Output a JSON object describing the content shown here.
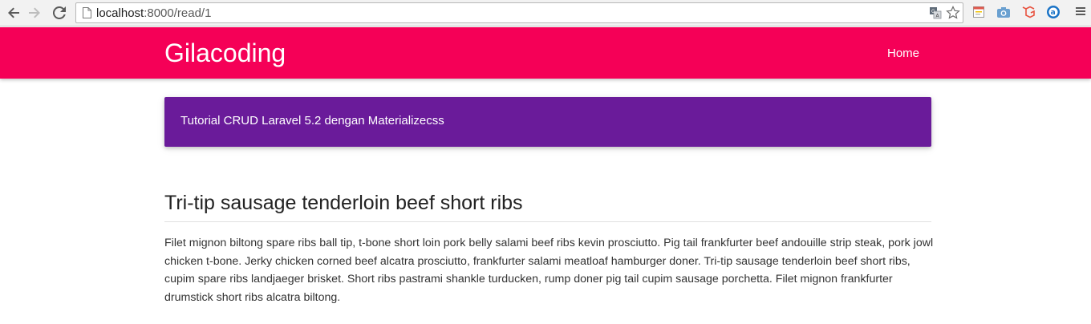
{
  "browser": {
    "url_host": "localhost",
    "url_path": ":8000/read/1",
    "icons": {
      "back": "back-arrow-icon",
      "forward": "forward-arrow-icon",
      "reload": "reload-icon",
      "page": "page-icon",
      "translate": "translate-icon",
      "bookmark": "star-icon",
      "extensions": [
        "calendar-icon",
        "camera-icon",
        "laravel-icon",
        "a-circle-icon"
      ],
      "menu": "hamburger-menu-icon"
    }
  },
  "navbar": {
    "brand": "Gilacoding",
    "links": [
      {
        "label": "Home"
      }
    ],
    "color": "#f50057"
  },
  "banner": {
    "text": "Tutorial CRUD Laravel 5.2 dengan Materializecss",
    "color": "#6a1b9a"
  },
  "article": {
    "title": "Tri-tip sausage tenderloin beef short ribs",
    "body": "Filet mignon biltong spare ribs ball tip, t-bone short loin pork belly salami beef ribs kevin prosciutto. Pig tail frankfurter beef andouille strip steak, pork jowl chicken t-bone. Jerky chicken corned beef alcatra prosciutto, frankfurter salami meatloaf hamburger doner. Tri-tip sausage tenderloin beef short ribs, cupim spare ribs landjaeger brisket. Short ribs pastrami shankle turducken, rump doner pig tail cupim sausage porchetta. Filet mignon frankfurter drumstick short ribs alcatra biltong."
  }
}
